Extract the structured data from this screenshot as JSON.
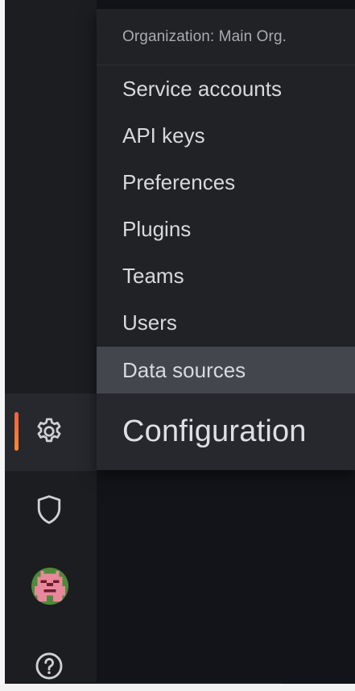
{
  "menu": {
    "header": "Organization: Main Org.",
    "items": [
      {
        "label": "Service accounts"
      },
      {
        "label": "API keys"
      },
      {
        "label": "Preferences"
      },
      {
        "label": "Plugins"
      },
      {
        "label": "Teams"
      },
      {
        "label": "Users"
      },
      {
        "label": "Data sources",
        "selected": true
      }
    ],
    "section_title": "Configuration"
  },
  "sidebar": {
    "items": [
      {
        "icon": "gear-icon",
        "active": true
      },
      {
        "icon": "shield-icon"
      },
      {
        "icon": "avatar"
      },
      {
        "icon": "help-icon"
      }
    ]
  },
  "colors": {
    "sidebar_bg": "#1c1d21",
    "menu_bg": "#212226",
    "selected_bg": "#44464d",
    "active_accent": "#f55f3e",
    "text": "#d8d9dd",
    "muted_text": "#a9abb1"
  }
}
